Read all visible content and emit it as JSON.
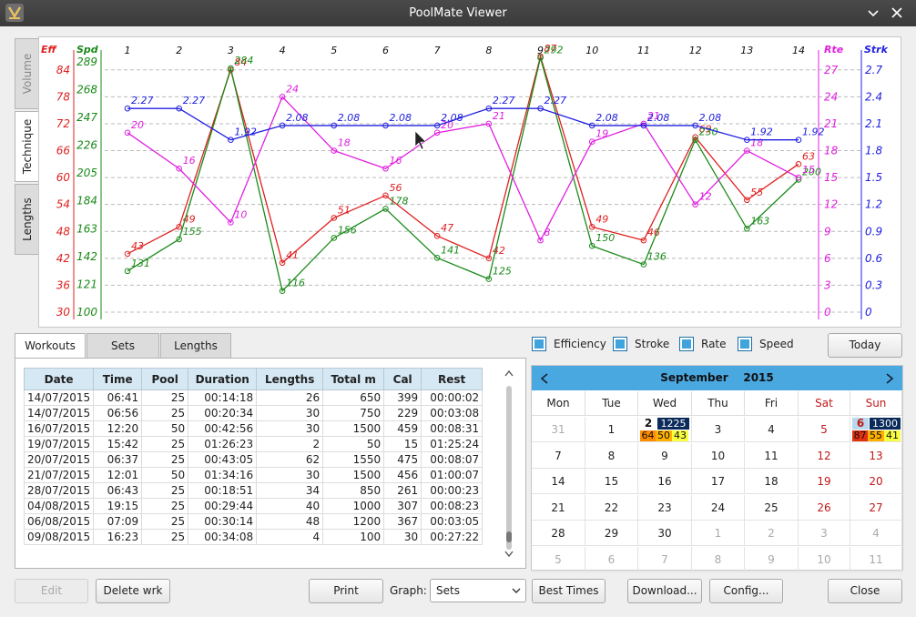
{
  "window": {
    "title": "PoolMate Viewer"
  },
  "vtabs": [
    "Volume",
    "Technique",
    "Lengths"
  ],
  "chart_data": {
    "type": "line",
    "x": [
      1,
      2,
      3,
      4,
      5,
      6,
      7,
      8,
      9,
      10,
      11,
      12,
      13,
      14
    ],
    "axes": {
      "eff": {
        "label": "Eff",
        "ticks": [
          30,
          36,
          42,
          48,
          54,
          60,
          66,
          72,
          78,
          84
        ],
        "ylim": [
          30,
          87
        ],
        "color": "#e02020"
      },
      "spd": {
        "label": "Spd",
        "ticks": [
          100,
          121,
          142,
          163,
          184,
          205,
          226,
          247,
          268,
          289
        ],
        "ylim": [
          100,
          293
        ],
        "color": "#1a8a1a"
      },
      "rte": {
        "label": "Rte",
        "ticks": [
          0,
          3,
          6,
          9,
          12,
          15,
          18,
          21,
          24,
          27
        ],
        "ylim": [
          0,
          28.5
        ],
        "color": "#e020e0"
      },
      "strk": {
        "label": "Strk",
        "ticks": [
          "0",
          "0.3",
          "0.6",
          "0.9",
          "1.2",
          "1.5",
          "1.8",
          "2.1",
          "2.4",
          "2.7"
        ],
        "ylim": [
          0,
          2.85
        ],
        "color": "#2020e0"
      }
    },
    "series": [
      {
        "name": "Efficiency",
        "axis": "eff",
        "color": "#e02020",
        "values": [
          43,
          49,
          84,
          41,
          51,
          56,
          47,
          42,
          87,
          49,
          46,
          69,
          55,
          63
        ]
      },
      {
        "name": "Speed",
        "axis": "spd",
        "color": "#1a8a1a",
        "values": [
          131,
          155,
          284,
          116,
          156,
          178,
          141,
          125,
          292,
          150,
          136,
          230,
          163,
          200
        ]
      },
      {
        "name": "Rate",
        "axis": "rte",
        "color": "#e020e0",
        "values": [
          20,
          16,
          10,
          24,
          18,
          16,
          20,
          21,
          8,
          19,
          21,
          12,
          18,
          15
        ]
      },
      {
        "name": "Stroke",
        "axis": "strk",
        "color": "#2020e0",
        "values": [
          2.27,
          2.27,
          1.92,
          2.08,
          2.08,
          2.08,
          2.08,
          2.27,
          2.27,
          2.08,
          2.08,
          2.08,
          1.92,
          1.92
        ]
      }
    ]
  },
  "legend": {
    "efficiency": "Efficiency",
    "stroke": "Stroke",
    "rate": "Rate",
    "speed": "Speed"
  },
  "today_label": "Today",
  "tabs": [
    "Workouts",
    "Sets",
    "Lengths"
  ],
  "table": {
    "headers": [
      "Date",
      "Time",
      "Pool",
      "Duration",
      "Lengths",
      "Total m",
      "Cal",
      "Rest"
    ],
    "rows": [
      [
        "14/07/2015",
        "06:41",
        "25",
        "00:14:18",
        "26",
        "650",
        "399",
        "00:00:02"
      ],
      [
        "14/07/2015",
        "06:56",
        "25",
        "00:20:34",
        "30",
        "750",
        "229",
        "00:03:08"
      ],
      [
        "16/07/2015",
        "12:20",
        "50",
        "00:42:56",
        "30",
        "1500",
        "459",
        "00:08:31"
      ],
      [
        "19/07/2015",
        "15:42",
        "25",
        "01:26:23",
        "2",
        "50",
        "15",
        "01:25:24"
      ],
      [
        "20/07/2015",
        "06:37",
        "25",
        "00:43:05",
        "62",
        "1550",
        "475",
        "00:08:07"
      ],
      [
        "21/07/2015",
        "12:01",
        "50",
        "01:34:16",
        "30",
        "1500",
        "456",
        "01:00:07"
      ],
      [
        "28/07/2015",
        "06:43",
        "25",
        "00:18:51",
        "34",
        "850",
        "261",
        "00:00:23"
      ],
      [
        "04/08/2015",
        "19:15",
        "25",
        "00:29:44",
        "40",
        "1000",
        "307",
        "00:08:23"
      ],
      [
        "06/08/2015",
        "07:09",
        "25",
        "00:30:14",
        "48",
        "1200",
        "367",
        "00:03:05"
      ],
      [
        "09/08/2015",
        "16:23",
        "25",
        "00:34:08",
        "4",
        "100",
        "30",
        "00:27:22"
      ]
    ]
  },
  "calendar": {
    "month": "September",
    "year": "2015",
    "dow": [
      "Mon",
      "Tue",
      "Wed",
      "Thu",
      "Fri",
      "Sat",
      "Sun"
    ],
    "weeks": [
      [
        "31",
        "1",
        "2",
        "3",
        "4",
        "5",
        "6"
      ],
      [
        "7",
        "8",
        "9",
        "10",
        "11",
        "12",
        "13"
      ],
      [
        "14",
        "15",
        "16",
        "17",
        "18",
        "19",
        "20"
      ],
      [
        "21",
        "22",
        "23",
        "24",
        "25",
        "26",
        "27"
      ],
      [
        "28",
        "29",
        "30",
        "1",
        "2",
        "3",
        "4"
      ],
      [
        "5",
        "6",
        "7",
        "8",
        "9",
        "10",
        "11"
      ]
    ],
    "wed_badge": {
      "dist": "1225",
      "a": "64",
      "b": "50",
      "c": "43"
    },
    "sun_badge": {
      "dist": "1300",
      "a": "87",
      "b": "55",
      "c": "41"
    }
  },
  "buttons": {
    "edit": "Edit",
    "delete": "Delete wrk",
    "print": "Print",
    "graph_label": "Graph:",
    "graph_value": "Sets",
    "best": "Best Times",
    "download": "Download...",
    "config": "Config...",
    "close": "Close"
  }
}
